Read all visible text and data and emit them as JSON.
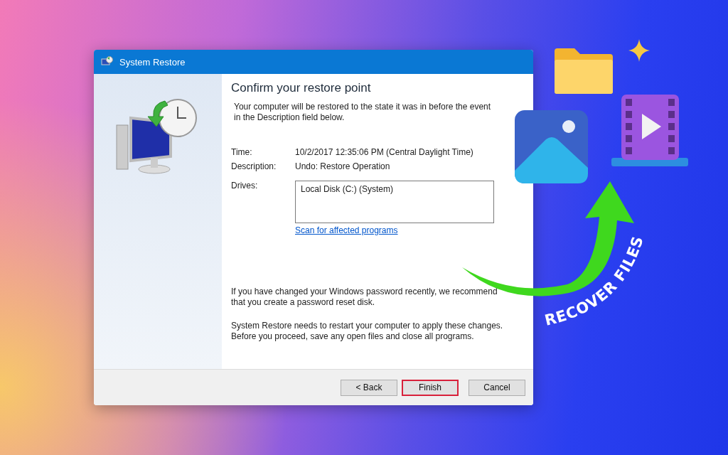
{
  "window": {
    "title": "System Restore"
  },
  "heading": "Confirm your restore point",
  "intro": "Your computer will be restored to the state it was in before the event in the Description field below.",
  "details": [
    {
      "label": "Time:",
      "value": "10/2/2017 12:35:06 PM (Central Daylight Time)"
    },
    {
      "label": "Description:",
      "value": "Undo: Restore Operation"
    }
  ],
  "drives": {
    "label": "Drives:",
    "items": [
      "Local Disk (C:) (System)"
    ]
  },
  "scan_link": "Scan for affected programs",
  "notes": [
    "If you have changed your Windows password recently, we recommend that you create a password reset disk.",
    "System Restore needs to restart your computer to apply these changes. Before you proceed, save any open files and close all programs."
  ],
  "buttons": [
    {
      "label": "< Back",
      "highlighted": false
    },
    {
      "label": "Finish",
      "highlighted": true
    },
    {
      "label": "Cancel",
      "highlighted": false
    }
  ],
  "overlay": {
    "caption": "RECOVER FILES"
  }
}
